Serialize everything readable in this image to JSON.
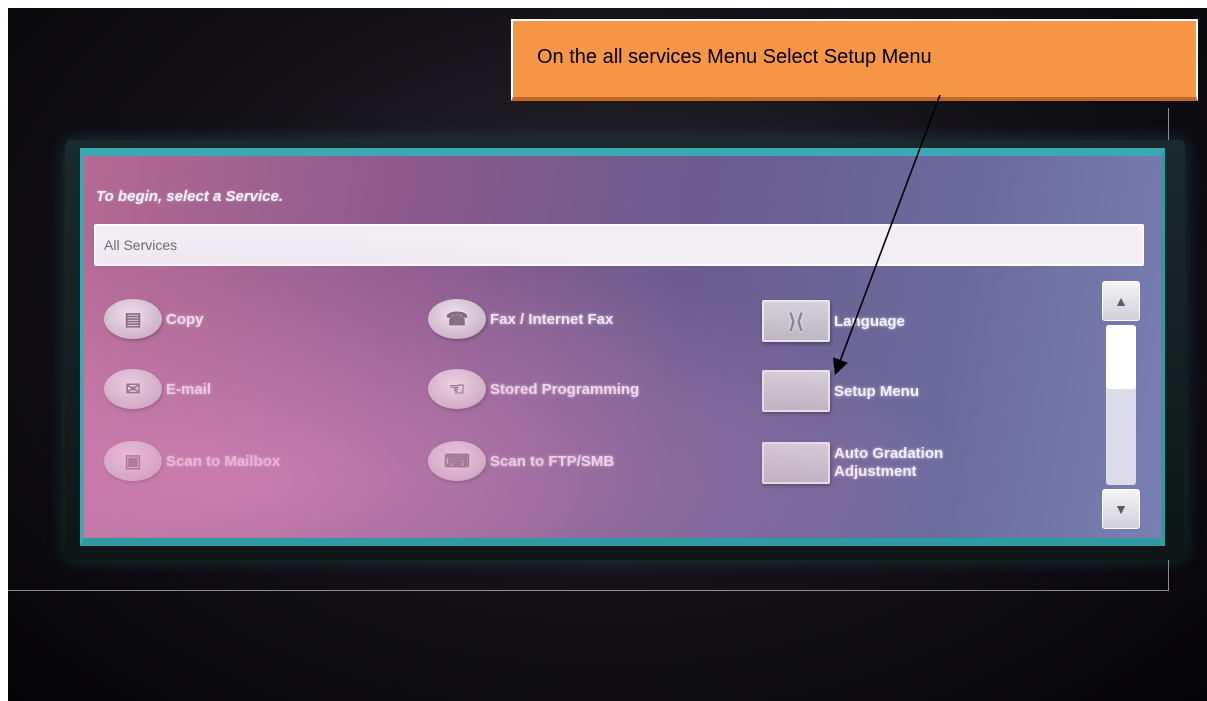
{
  "callout": {
    "text": "On the all services Menu Select Setup Menu"
  },
  "screen": {
    "prompt": "To begin, select a Service.",
    "services_bar_label": "All Services",
    "services": {
      "copy": "Copy",
      "fax": "Fax / Internet Fax",
      "language": "Language",
      "email": "E-mail",
      "stored_programming": "Stored Programming",
      "setup_menu": "Setup Menu",
      "scan_to_mailbox": "Scan to Mailbox",
      "scan_to_ftp": "Scan to FTP/SMB",
      "auto_gradation_line1": "Auto Gradation",
      "auto_gradation_line2": "Adjustment"
    },
    "scroll": {
      "up_glyph": "▲",
      "down_glyph": "▼"
    }
  },
  "icons": {
    "copy": "copy-icon",
    "fax": "fax-icon",
    "language": "language-icon",
    "email": "email-icon",
    "stored_programming": "stored-programming-icon",
    "scan_to_mailbox": "mailbox-icon",
    "scan_to_ftp": "ftp-icon"
  },
  "colors": {
    "callout_bg": "#f79646",
    "screen_accent": "#3aa9b3"
  }
}
